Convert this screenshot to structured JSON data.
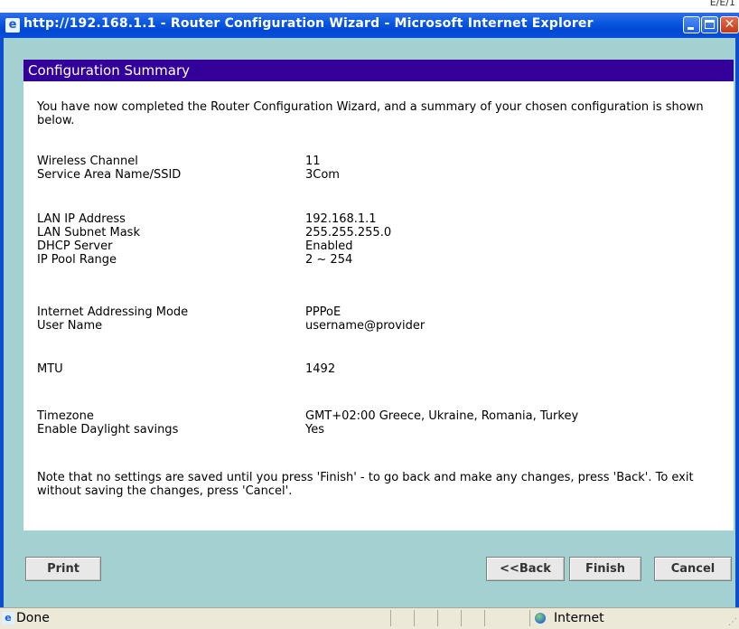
{
  "window": {
    "title": "http://192.168.1.1 - Router Configuration Wizard - Microsoft Internet Explorer",
    "corner_text": "E/E/1"
  },
  "panel": {
    "header": "Configuration Summary",
    "intro": "You have now completed the Router Configuration Wizard, and a summary of your chosen configuration is shown below.",
    "fields": [
      {
        "label": "Wireless Channel",
        "value": "11"
      },
      {
        "label": "Service Area Name/SSID",
        "value": "3Com"
      },
      {
        "label": "LAN IP Address",
        "value": "192.168.1.1"
      },
      {
        "label": "LAN Subnet Mask",
        "value": "255.255.255.0"
      },
      {
        "label": "DHCP Server",
        "value": "Enabled"
      },
      {
        "label": "IP Pool Range",
        "value": "2 ~ 254"
      },
      {
        "label": "Internet Addressing Mode",
        "value": "PPPoE"
      },
      {
        "label": "User Name",
        "value": "username@provider"
      },
      {
        "label": "MTU",
        "value": "1492"
      },
      {
        "label": "Timezone",
        "value": "GMT+02:00 Greece, Ukraine, Romania, Turkey"
      },
      {
        "label": "Enable Daylight savings",
        "value": "Yes"
      }
    ],
    "note": "Note that no settings are saved until you press 'Finish' - to go back and make any changes, press 'Back'. To exit without saving the changes, press 'Cancel'."
  },
  "buttons": {
    "print": "Print",
    "back": "<<Back",
    "finish": "Finish",
    "cancel": "Cancel"
  },
  "statusbar": {
    "status": "Done",
    "zone": "Internet"
  }
}
